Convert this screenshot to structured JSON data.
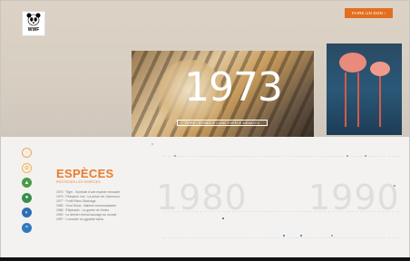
{
  "header": {
    "logo_text": "WWF",
    "cta_label": "Faire un don  ›"
  },
  "hero": {
    "year": "1973",
    "caption": "Tigre : Symbole d'une espèce menacée"
  },
  "sidebar": {
    "icons": [
      {
        "name": "globe-icon",
        "color": "#f4a15c"
      },
      {
        "name": "animal-paw-icon",
        "color": "#f6b24c"
      },
      {
        "name": "forest-icon",
        "color": "#4c9a4a"
      },
      {
        "name": "leaf-icon",
        "color": "#3a8e4a"
      },
      {
        "name": "water-drop-icon",
        "color": "#2e6fb3"
      },
      {
        "name": "wave-icon",
        "color": "#2e79c1"
      }
    ]
  },
  "section": {
    "title": "ESPÈCES",
    "subtitle": "Protéger les espèces"
  },
  "timeline": {
    "items": [
      "1973 · Tigre - Symbole d'une espèce menacée",
      "1975 · Plumpton Lee - La prison de Cameroun",
      "1977 · Profil Rhino Sitatunga",
      "1980 · Orca Sinus - Baleine communautaire",
      "1986 · Éléphants - La guerre de l'ivoire",
      "1990 · Le dernier cheval sauvage au monde",
      "1997 · L'envolée du gypaète barbu"
    ],
    "decades": [
      "1980",
      "1990"
    ]
  }
}
